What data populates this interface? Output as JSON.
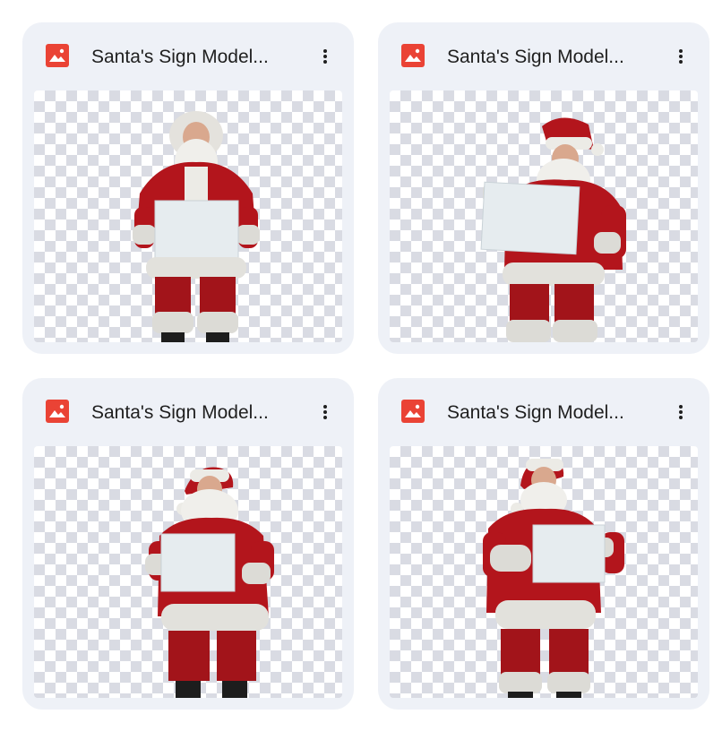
{
  "files": [
    {
      "title": "Santa's Sign Model...",
      "icon": "image-file-icon",
      "icon_color": "#ea4335"
    },
    {
      "title": "Santa's Sign Model...",
      "icon": "image-file-icon",
      "icon_color": "#ea4335"
    },
    {
      "title": "Santa's Sign Model...",
      "icon": "image-file-icon",
      "icon_color": "#ea4335"
    },
    {
      "title": "Santa's Sign Model...",
      "icon": "image-file-icon",
      "icon_color": "#ea4335"
    }
  ],
  "more_menu_icon": "more-vert-icon",
  "colors": {
    "card_background": "#eef1f7",
    "suit_red": "#b3151c",
    "fur_white": "#ecebe6",
    "sign": "#e6ecef"
  }
}
